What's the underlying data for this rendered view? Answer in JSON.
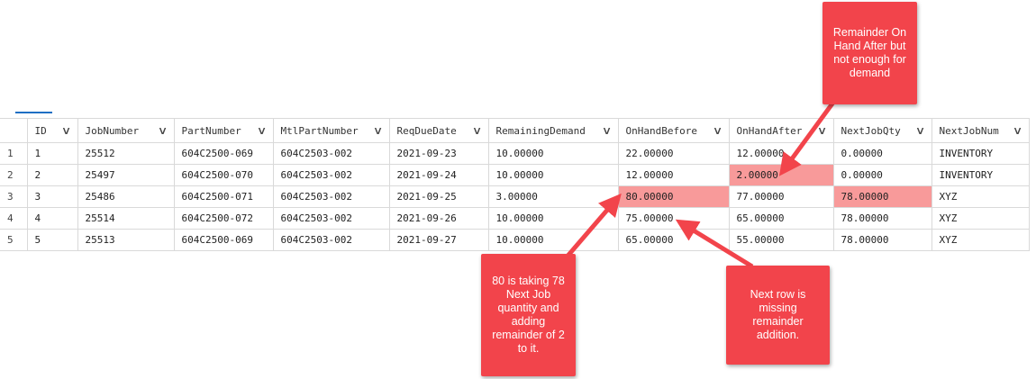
{
  "grid": {
    "columns": [
      "ID",
      "JobNumber",
      "PartNumber",
      "MtlPartNumber",
      "ReqDueDate",
      "RemainingDemand",
      "OnHandBefore",
      "OnHandAfter",
      "NextJobQty",
      "NextJobNum"
    ],
    "rows": [
      {
        "rownum": "1",
        "cells": [
          "1",
          "25512",
          "604C2500-069",
          "604C2503-002",
          "2021-09-23",
          "10.00000",
          "22.00000",
          "12.00000",
          "0.00000",
          "INVENTORY"
        ]
      },
      {
        "rownum": "2",
        "cells": [
          "2",
          "25497",
          "604C2500-070",
          "604C2503-002",
          "2021-09-24",
          "10.00000",
          "12.00000",
          "2.00000",
          "0.00000",
          "INVENTORY"
        ]
      },
      {
        "rownum": "3",
        "cells": [
          "3",
          "25486",
          "604C2500-071",
          "604C2503-002",
          "2021-09-25",
          "3.00000",
          "80.00000",
          "77.00000",
          "78.00000",
          "XYZ"
        ]
      },
      {
        "rownum": "4",
        "cells": [
          "4",
          "25514",
          "604C2500-072",
          "604C2503-002",
          "2021-09-26",
          "10.00000",
          "75.00000",
          "65.00000",
          "78.00000",
          "XYZ"
        ]
      },
      {
        "rownum": "5",
        "cells": [
          "5",
          "25513",
          "604C2500-069",
          "604C2503-002",
          "2021-09-27",
          "10.00000",
          "65.00000",
          "55.00000",
          "78.00000",
          "XYZ"
        ]
      }
    ]
  },
  "callouts": {
    "top": "Remainder On Hand After but not enough for demand",
    "left": "80 is taking 78 Next Job quantity and adding remainder of 2 to it.",
    "right": "Next row is missing remainder addition."
  },
  "colors": {
    "highlight": "#f89a9a",
    "callout": "#f2444b",
    "tab_accent": "#1f6fc4"
  }
}
